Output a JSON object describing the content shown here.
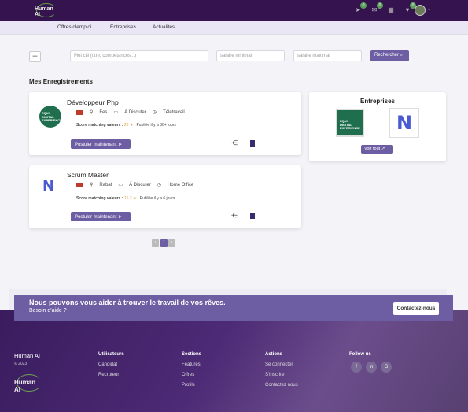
{
  "header": {
    "logo_text": "Human AI",
    "icons": [
      {
        "name": "send-icon",
        "badge": "0"
      },
      {
        "name": "mail-icon",
        "badge": "0"
      },
      {
        "name": "calendar-icon",
        "badge": ""
      },
      {
        "name": "heart-icon",
        "badge": "0"
      }
    ]
  },
  "nav": {
    "items": [
      "Offres d'emploi",
      "Entreprises",
      "Actualités"
    ]
  },
  "search": {
    "keyword_placeholder": "Mot clé (titre, compétances...)",
    "min_salary_placeholder": "salaire minimal",
    "max_salary_placeholder": "salaire maximal",
    "button_label": "Rechercher"
  },
  "section_title": "Mes Enregistrements",
  "jobs": [
    {
      "title": "Développeur Php",
      "city": "Fes",
      "salary": "À Discuter",
      "mode": "Télétravail",
      "score_label": "Score matching valeurs :",
      "score_value": "20",
      "published": "Publiée il y a 30+ jours",
      "apply_label": "Postuler maintenant",
      "logo_text": "EQUI DIGITAL EXPERIENCE"
    },
    {
      "title": "Scrum Master",
      "city": "Rabat",
      "salary": "À Discuter",
      "mode": "Home Office",
      "score_label": "Score matching valeurs :",
      "score_value": "16.3",
      "published": "Publiée il y a 6 jours",
      "apply_label": "Postuler maintenant",
      "logo_text": "N"
    }
  ],
  "companies": {
    "title": "Entreprises",
    "logo1_text": "EQUI DIGITAL EXPERIENCE",
    "logo2_text": "N",
    "view_all_label": "Voir tout"
  },
  "pagination": {
    "prev": "‹",
    "current": "1",
    "next": "›"
  },
  "cta": {
    "title": "Nous pouvons vous aider à trouver le travail de vos rêves.",
    "subtitle": "Besoin d'aide ?",
    "button_label": "Contactez-nous"
  },
  "footer": {
    "brand": "Human AI",
    "copyright": "© 2023",
    "logo_text": "Human AI",
    "columns": [
      {
        "title": "Utilisateurs",
        "links": [
          "Candidat",
          "Recruteur"
        ]
      },
      {
        "title": "Sections",
        "links": [
          "Features",
          "Offres",
          "Profils"
        ]
      },
      {
        "title": "Actions",
        "links": [
          "Se connecter",
          "S'inscrire",
          "Contactez nous"
        ]
      }
    ],
    "follow_title": "Follow us",
    "socials": [
      "f",
      "in",
      "G"
    ]
  },
  "colors": {
    "header_bg": "#34134f",
    "accent": "#6d5ea3",
    "star": "#e2a33a"
  }
}
